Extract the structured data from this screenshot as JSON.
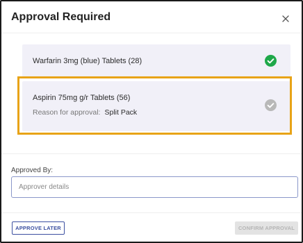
{
  "dialog": {
    "title": "Approval Required"
  },
  "items": [
    {
      "name": "Warfarin 3mg (blue) Tablets (28)",
      "status": "approved",
      "status_color": "#1fa84a"
    },
    {
      "name": "Aspirin 75mg g/r Tablets (56)",
      "reason_label": "Reason for approval:",
      "reason_value": "Split Pack",
      "status": "pending",
      "status_color": "#b8b8b8",
      "highlighted": true
    }
  ],
  "approver": {
    "label": "Approved By:",
    "placeholder": "Approver details",
    "value": ""
  },
  "footer": {
    "approve_later_label": "APPROVE LATER",
    "confirm_label": "CONFIRM APPROVAL",
    "confirm_enabled": false
  },
  "colors": {
    "accent": "#3b4fa0",
    "highlight": "#e8a317",
    "item_bg": "#f1f0f8"
  },
  "icons": {
    "close": "close-icon",
    "approved": "check-circle-icon",
    "pending": "check-circle-icon"
  }
}
